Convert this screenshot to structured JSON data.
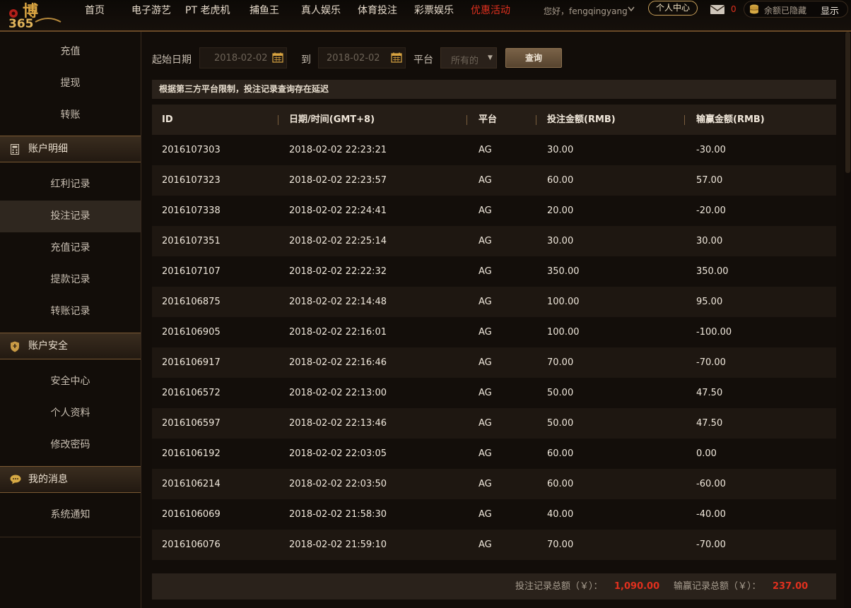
{
  "header": {
    "logo_text": "博 365",
    "nav": [
      {
        "label": "首页",
        "promo": false
      },
      {
        "label": "电子游艺",
        "promo": false
      },
      {
        "label": "PT 老虎机",
        "promo": false
      },
      {
        "label": "捕鱼王",
        "promo": false
      },
      {
        "label": "真人娱乐",
        "promo": false
      },
      {
        "label": "体育投注",
        "promo": false
      },
      {
        "label": "彩票娱乐",
        "promo": false
      },
      {
        "label": "优惠活动",
        "promo": true
      }
    ],
    "greeting": "您好，fengqingyang",
    "personal_center": "个人中心",
    "mail_count": "0",
    "balance_hidden": "余额已隐藏",
    "show_label": "显示"
  },
  "sidebar": {
    "top_items": [
      "充值",
      "提现",
      "转账"
    ],
    "sections": [
      {
        "title": "账户明细",
        "icon": "calculator-icon",
        "items": [
          "红利记录",
          "投注记录",
          "充值记录",
          "提款记录",
          "转账记录"
        ]
      },
      {
        "title": "账户安全",
        "icon": "shield-icon",
        "items": [
          "安全中心",
          "个人资料",
          "修改密码"
        ]
      },
      {
        "title": "我的消息",
        "icon": "chat-bubble-icon",
        "items": [
          "系统通知"
        ]
      }
    ],
    "active_item": "投注记录"
  },
  "filter": {
    "start_label": "起始日期",
    "start_value": "2018-02-02",
    "to_label": "到",
    "end_value": "2018-02-02",
    "platform_label": "平台",
    "platform_value": "所有的",
    "query_label": "查询"
  },
  "notice": "根据第三方平台限制，投注记录查询存在延迟",
  "table": {
    "columns": [
      "ID",
      "日期/时间(GMT+8)",
      "平台",
      "投注金额(RMB)",
      "输赢金额(RMB)"
    ],
    "rows": [
      [
        "2016107303",
        "2018-02-02 22:23:21",
        "AG",
        "30.00",
        "-30.00"
      ],
      [
        "2016107323",
        "2018-02-02 22:23:57",
        "AG",
        "60.00",
        "57.00"
      ],
      [
        "2016107338",
        "2018-02-02 22:24:41",
        "AG",
        "20.00",
        "-20.00"
      ],
      [
        "2016107351",
        "2018-02-02 22:25:14",
        "AG",
        "30.00",
        "30.00"
      ],
      [
        "2016107107",
        "2018-02-02 22:22:32",
        "AG",
        "350.00",
        "350.00"
      ],
      [
        "2016106875",
        "2018-02-02 22:14:48",
        "AG",
        "100.00",
        "95.00"
      ],
      [
        "2016106905",
        "2018-02-02 22:16:01",
        "AG",
        "100.00",
        "-100.00"
      ],
      [
        "2016106917",
        "2018-02-02 22:16:46",
        "AG",
        "70.00",
        "-70.00"
      ],
      [
        "2016106572",
        "2018-02-02 22:13:00",
        "AG",
        "50.00",
        "47.50"
      ],
      [
        "2016106597",
        "2018-02-02 22:13:46",
        "AG",
        "50.00",
        "47.50"
      ],
      [
        "2016106192",
        "2018-02-02 22:03:05",
        "AG",
        "60.00",
        "0.00"
      ],
      [
        "2016106214",
        "2018-02-02 22:03:50",
        "AG",
        "60.00",
        "-60.00"
      ],
      [
        "2016106069",
        "2018-02-02 21:58:30",
        "AG",
        "40.00",
        "-40.00"
      ],
      [
        "2016106076",
        "2018-02-02 21:59:10",
        "AG",
        "70.00",
        "-70.00"
      ]
    ]
  },
  "summary": {
    "bet_total_label": "投注记录总额（￥）：",
    "bet_total_value": "1,090.00",
    "win_total_label": "输赢记录总额（￥）：",
    "win_total_value": "237.00"
  },
  "colors": {
    "accent_red": "#e0301e",
    "gold": "#c9a05a",
    "background": "#120d09"
  }
}
